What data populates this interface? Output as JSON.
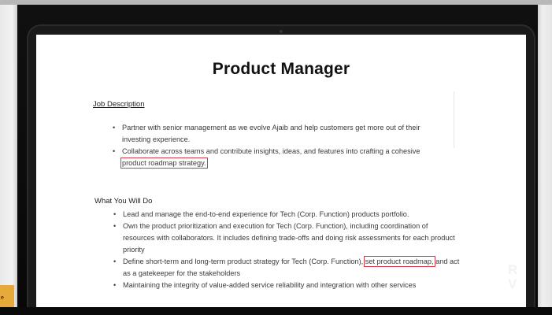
{
  "document": {
    "title": "Product Manager",
    "job_description": {
      "heading": "Job Description",
      "items": [
        {
          "text_before": "Partner with senior management as we evolve Ajaib and help customers get more out of their investing experience.",
          "highlight": "",
          "text_after": ""
        },
        {
          "text_before": "Collaborate across teams and contribute insights, ideas, and features into crafting a cohesive ",
          "highlight": "product roadmap strategy.",
          "text_after": ""
        }
      ]
    },
    "what_you_will_do": {
      "heading": "What You Will Do",
      "items": [
        {
          "text_before": "Lead and manage the end-to-end experience for Tech (Corp. Function) products portfolio.",
          "highlight": "",
          "text_after": ""
        },
        {
          "text_before": "Own the product prioritization and execution for Tech (Corp. Function), including coordination of resources with collaborators. It includes defining trade-offs and doing risk assessments for each product priority",
          "highlight": "",
          "text_after": ""
        },
        {
          "text_before": "Define short-term and long-term product strategy for Tech (Corp. Function), ",
          "highlight": "set product roadmap,",
          "text_after": " and act as a gatekeeper for the stakeholders"
        },
        {
          "text_before": "Maintaining the integrity of value-added service reliability and integration with other services",
          "highlight": "",
          "text_after": ""
        }
      ]
    }
  },
  "overlay": {
    "badge_line_1": "R",
    "badge_line_2": "V",
    "left_tab_text": "e"
  },
  "colors": {
    "highlight_box": "#d23a4a",
    "left_tab": "#e6a93a",
    "screen_bg": "#ffffff",
    "bezel": "#1a1a1a"
  }
}
